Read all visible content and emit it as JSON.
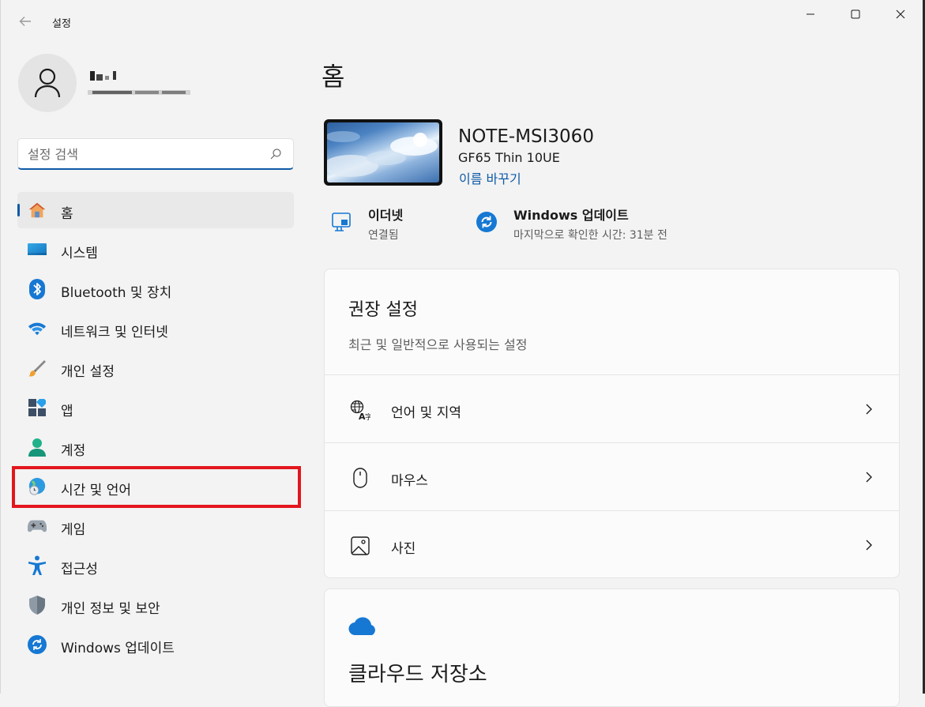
{
  "window": {
    "app_title": "설정",
    "controls": [
      "minimize",
      "maximize",
      "close"
    ]
  },
  "search": {
    "placeholder": "설정 검색"
  },
  "sidebar": {
    "items": [
      {
        "label": "홈",
        "icon": "home-icon",
        "active": true
      },
      {
        "label": "시스템",
        "icon": "system-icon"
      },
      {
        "label": "Bluetooth 및 장치",
        "icon": "bluetooth-icon"
      },
      {
        "label": "네트워크 및 인터넷",
        "icon": "wifi-icon"
      },
      {
        "label": "개인 설정",
        "icon": "brush-icon"
      },
      {
        "label": "앱",
        "icon": "apps-icon"
      },
      {
        "label": "계정",
        "icon": "account-icon"
      },
      {
        "label": "시간 및 언어",
        "icon": "globe-clock-icon",
        "highlighted": true
      },
      {
        "label": "게임",
        "icon": "gamepad-icon"
      },
      {
        "label": "접근성",
        "icon": "accessibility-icon"
      },
      {
        "label": "개인 정보 및 보안",
        "icon": "shield-icon"
      },
      {
        "label": "Windows 업데이트",
        "icon": "update-icon"
      }
    ]
  },
  "main": {
    "page_title": "홈",
    "device": {
      "name": "NOTE-MSI3060",
      "model": "GF65 Thin 10UE",
      "rename_link": "이름 바꾸기"
    },
    "status": [
      {
        "title": "이더넷",
        "subtitle": "연결됨",
        "icon": "ethernet-icon"
      },
      {
        "title": "Windows 업데이트",
        "subtitle": "마지막으로 확인한 시간: 31분 전",
        "icon": "update-icon"
      }
    ],
    "recommended": {
      "title": "권장 설정",
      "subtitle": "최근 및 일반적으로 사용되는 설정",
      "rows": [
        {
          "label": "언어 및 지역",
          "icon": "language-icon"
        },
        {
          "label": "마우스",
          "icon": "mouse-icon"
        },
        {
          "label": "사진",
          "icon": "photo-icon"
        }
      ]
    },
    "cloud": {
      "title": "클라우드 저장소",
      "icon": "cloud-icon"
    }
  },
  "colors": {
    "accent": "#0f5aa8",
    "highlight_box": "#e3161d",
    "background": "#f3f3f3"
  }
}
